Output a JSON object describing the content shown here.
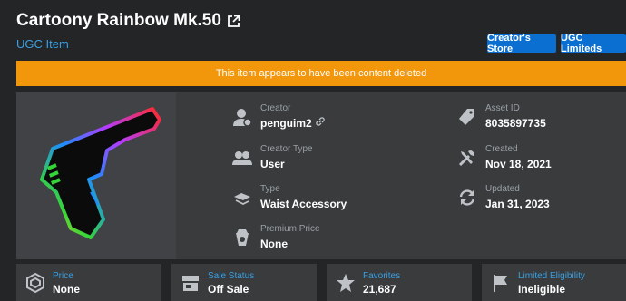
{
  "header": {
    "title": "Cartoony Rainbow Mk.50",
    "subtitle": "UGC Item",
    "creators_store_label": "Creator's Store",
    "ugc_limiteds_label": "UGC Limiteds"
  },
  "banner": {
    "text": "This item appears to have been content deleted"
  },
  "details": {
    "creator": {
      "label": "Creator",
      "value": "penguim2"
    },
    "creator_type": {
      "label": "Creator Type",
      "value": "User"
    },
    "type": {
      "label": "Type",
      "value": "Waist Accessory"
    },
    "premium_price": {
      "label": "Premium Price",
      "value": "None"
    },
    "asset_id": {
      "label": "Asset ID",
      "value": "8035897735"
    },
    "created": {
      "label": "Created",
      "value": "Nov 18, 2021"
    },
    "updated": {
      "label": "Updated",
      "value": "Jan 31, 2023"
    }
  },
  "stats": {
    "price": {
      "label": "Price",
      "value": "None"
    },
    "sale_status": {
      "label": "Sale Status",
      "value": "Off Sale"
    },
    "favorites": {
      "label": "Favorites",
      "value": "21,687"
    },
    "limited_eligibility": {
      "label": "Limited Eligibility",
      "value": "Ineligible"
    }
  },
  "colors": {
    "accent": "#0a6fd1",
    "link": "#3a9fe0",
    "warning": "#f2960c",
    "background": "#232527",
    "card": "#393b3d"
  },
  "icons": [
    "external-link-icon",
    "user-icon",
    "link-icon",
    "users-icon",
    "accessory-icon",
    "premium-icon",
    "tag-icon",
    "tools-icon",
    "refresh-icon",
    "robux-icon",
    "shop-icon",
    "star-icon",
    "flag-icon"
  ]
}
